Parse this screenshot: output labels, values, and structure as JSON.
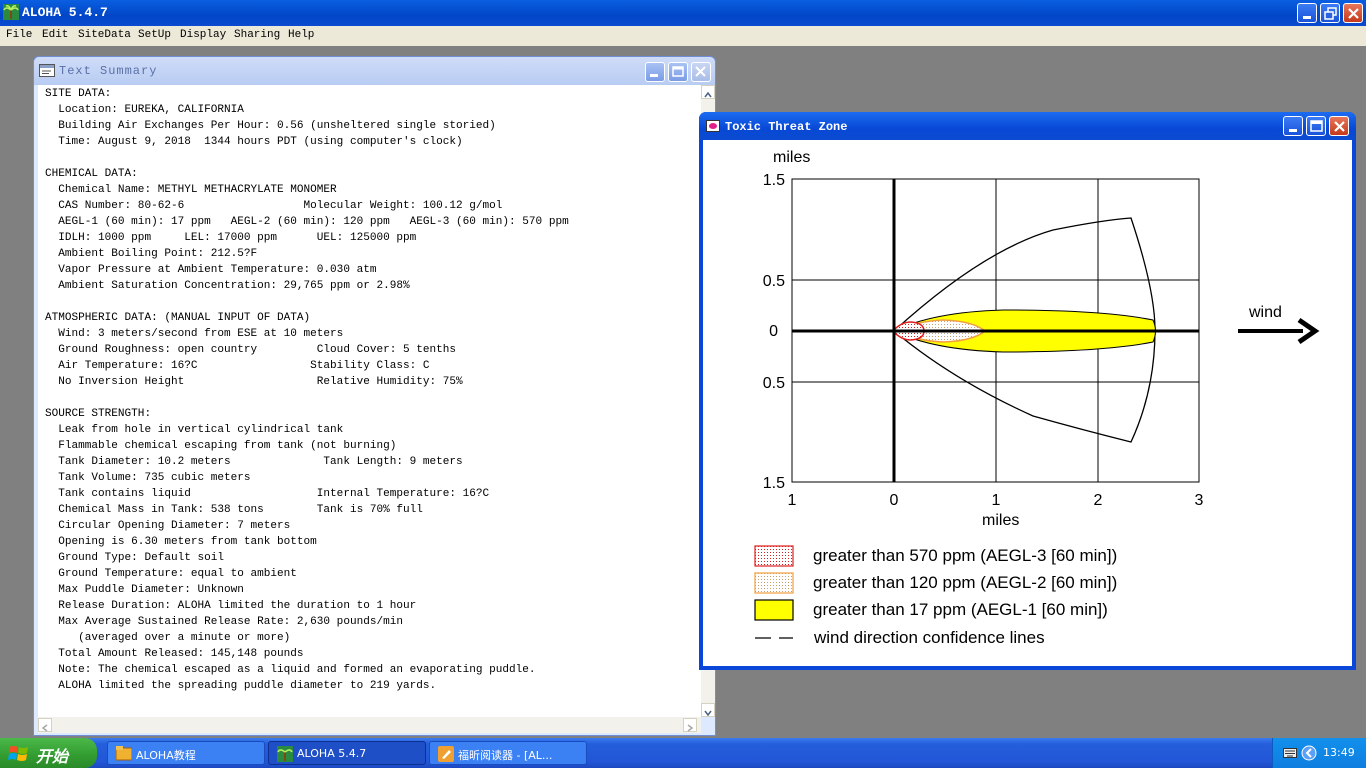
{
  "app": {
    "title": "ALOHA 5.4.7",
    "menu": [
      "File",
      "Edit",
      "SiteData",
      "SetUp",
      "Display",
      "Sharing",
      "Help"
    ]
  },
  "summary_window": {
    "title": "Text Summary",
    "lines": [
      "SITE DATA:",
      "  Location: EUREKA, CALIFORNIA",
      "  Building Air Exchanges Per Hour: 0.56 (unsheltered single storied)",
      "  Time: August 9, 2018  1344 hours PDT (using computer's clock)",
      "",
      "CHEMICAL DATA:",
      "  Chemical Name: METHYL METHACRYLATE MONOMER",
      "  CAS Number: 80-62-6                  Molecular Weight: 100.12 g/mol",
      "  AEGL-1 (60 min): 17 ppm   AEGL-2 (60 min): 120 ppm   AEGL-3 (60 min): 570 ppm",
      "  IDLH: 1000 ppm     LEL: 17000 ppm      UEL: 125000 ppm",
      "  Ambient Boiling Point: 212.5?F",
      "  Vapor Pressure at Ambient Temperature: 0.030 atm",
      "  Ambient Saturation Concentration: 29,765 ppm or 2.98%",
      "",
      "ATMOSPHERIC DATA: (MANUAL INPUT OF DATA)",
      "  Wind: 3 meters/second from ESE at 10 meters",
      "  Ground Roughness: open country         Cloud Cover: 5 tenths",
      "  Air Temperature: 16?C                 Stability Class: C",
      "  No Inversion Height                    Relative Humidity: 75%",
      "",
      "SOURCE STRENGTH:",
      "  Leak from hole in vertical cylindrical tank",
      "  Flammable chemical escaping from tank (not burning)",
      "  Tank Diameter: 10.2 meters              Tank Length: 9 meters",
      "  Tank Volume: 735 cubic meters",
      "  Tank contains liquid                   Internal Temperature: 16?C",
      "  Chemical Mass in Tank: 538 tons        Tank is 70% full",
      "  Circular Opening Diameter: 7 meters",
      "  Opening is 6.30 meters from tank bottom",
      "  Ground Type: Default soil",
      "  Ground Temperature: equal to ambient",
      "  Max Puddle Diameter: Unknown",
      "  Release Duration: ALOHA limited the duration to 1 hour",
      "  Max Average Sustained Release Rate: 2,630 pounds/min",
      "     (averaged over a minute or more)",
      "  Total Amount Released: 145,148 pounds",
      "  Note: The chemical escaped as a liquid and formed an evaporating puddle.",
      "  ALOHA limited the spreading puddle diameter to 219 yards."
    ]
  },
  "threat_window": {
    "title": "Toxic Threat Zone",
    "plot": {
      "y_unit": "miles",
      "x_unit": "miles",
      "y_ticks": [
        "1.5",
        "0.5",
        "0",
        "0.5",
        "1.5"
      ],
      "x_ticks": [
        "1",
        "0",
        "1",
        "2",
        "3"
      ],
      "wind_label": "wind"
    },
    "legend": [
      {
        "label": "greater than 570 ppm (AEGL-3 [60 min])",
        "color": "#e02020"
      },
      {
        "label": "greater than 120 ppm (AEGL-2 [60 min])",
        "color": "#f0a040"
      },
      {
        "label": "greater than 17 ppm (AEGL-1 [60 min])",
        "color": "#ffff00"
      },
      {
        "label": "wind direction confidence lines",
        "color": "#000000"
      }
    ]
  },
  "taskbar": {
    "start_label": "开始",
    "tasks": [
      "ALOHA教程",
      "ALOHA 5.4.7",
      "福昕阅读器 - [AL..."
    ],
    "clock": "13:49"
  }
}
